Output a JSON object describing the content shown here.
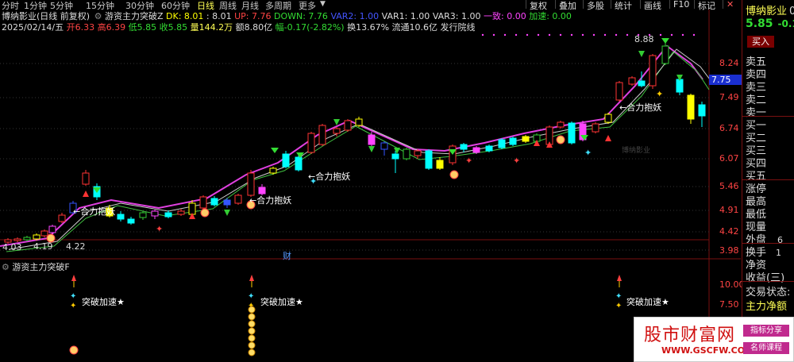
{
  "toolbar": {
    "periods": [
      "分时",
      "1分钟",
      "5分钟",
      "15分钟",
      "30分钟",
      "60分钟",
      "日线",
      "周线",
      "月线",
      "多周期",
      "更多"
    ],
    "active_period": "日线",
    "right_buttons": [
      "复权",
      "叠加",
      "多股",
      "统计",
      "画线",
      "F10",
      "标记"
    ],
    "settings_icon": "gear-icon",
    "close_icon": "close-icon"
  },
  "header": {
    "title": "博纳影业(日线 前复权)",
    "indicator_name": "游资主力突破Z",
    "dk": "DK: 8.01",
    "dk2": ": 8.01",
    "up": "UP: 7.76",
    "down": "DOWN: 7.76",
    "var2": "VAR2: 1.00",
    "var1": "VAR1: 1.00",
    "var3": "VAR3: 1.00",
    "yizhi": "一致: 0.00",
    "jiasu": "加速: 0.00",
    "date": "2025/02/14/五",
    "open": "开6.33",
    "high": "高6.39",
    "low": "低5.85",
    "close": "收5.85",
    "volume": "量144.2万",
    "amount": "额8.80亿",
    "change": "幅-0.17(-2.82%)",
    "turnover": "换13.67%",
    "float_cap": "流通10.6亿",
    "issue": "发行院线"
  },
  "colors": {
    "up": "#ff3333",
    "down": "#00ffff",
    "yellow": "#ffff00",
    "magenta": "#ff44ff",
    "green": "#33cc33",
    "bg": "#000000",
    "blue": "#3355ff"
  },
  "chart_data": {
    "type": "candlestick",
    "price_axis": [
      "8.24",
      "7.49",
      "6.74",
      "6.07",
      "5.46",
      "4.91",
      "4.42",
      "3.98"
    ],
    "current_price_label": "7.75",
    "peak_label": "8.88",
    "left_labels": [
      "4.03",
      "4.19",
      "4.22"
    ],
    "annotations": [
      "←合力抱妖",
      "←合力抱妖",
      "←合力抱妖",
      "←合力抱妖"
    ],
    "finance_marker": "财",
    "watermark_small": "博纳影业",
    "lower_panel": {
      "title": "游资主力突破F",
      "axis": [
        "10.00",
        "7.50"
      ],
      "signals": [
        "突破加速★",
        "突破加速★",
        "突破加速★"
      ]
    }
  },
  "right_panel": {
    "name": "博纳影业",
    "name_suffix": "0",
    "price": "5.85",
    "change": "-0.1",
    "buy_button": "买入",
    "order_book": [
      "卖五",
      "卖四",
      "卖三",
      "卖二",
      "卖一",
      "买一",
      "买二",
      "买三",
      "买四",
      "买五"
    ],
    "stats": [
      "涨停",
      "最高",
      "最低",
      "现量",
      "外盘"
    ],
    "outer_value": "6",
    "more": [
      "换手",
      "净资",
      "收益(三)"
    ],
    "turnover_value": "1",
    "trade_status": "交易状态:",
    "main_flow": "主力净额"
  },
  "watermark": {
    "site": "股市财富网",
    "url": "WWW.GSCFW.COM",
    "tag1": "指标分享",
    "tag2": "名师课程"
  }
}
